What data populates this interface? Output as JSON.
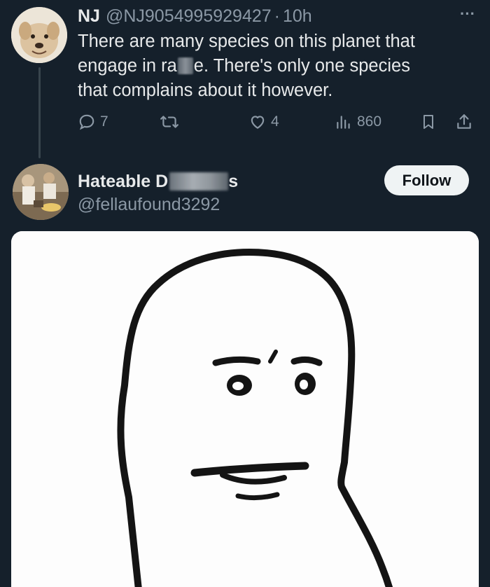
{
  "tweet": {
    "display_name": "NJ",
    "handle": "@NJ9054995929427",
    "separator": "·",
    "time": "10h",
    "text_line1": "There are many species on this planet that",
    "text_line2_a": "engage in ra",
    "text_line2_b": "e. There's only one species",
    "text_line3": "that complains about it however.",
    "actions": {
      "replies": "7",
      "likes": "4",
      "views": "860"
    },
    "more_label": "···"
  },
  "reply_author": {
    "name_start": "Hateable D",
    "name_end": "s",
    "handle": "@fellaufound3292",
    "follow_label": "Follow"
  },
  "colors": {
    "background": "#15202b",
    "text_primary": "#e7e9ea",
    "text_secondary": "#8b98a5",
    "follow_bg": "#eff3f4"
  },
  "icons": [
    "avatar",
    "more-icon",
    "reply-icon",
    "retweet-icon",
    "like-icon",
    "views-icon",
    "bookmark-icon",
    "share-icon"
  ]
}
